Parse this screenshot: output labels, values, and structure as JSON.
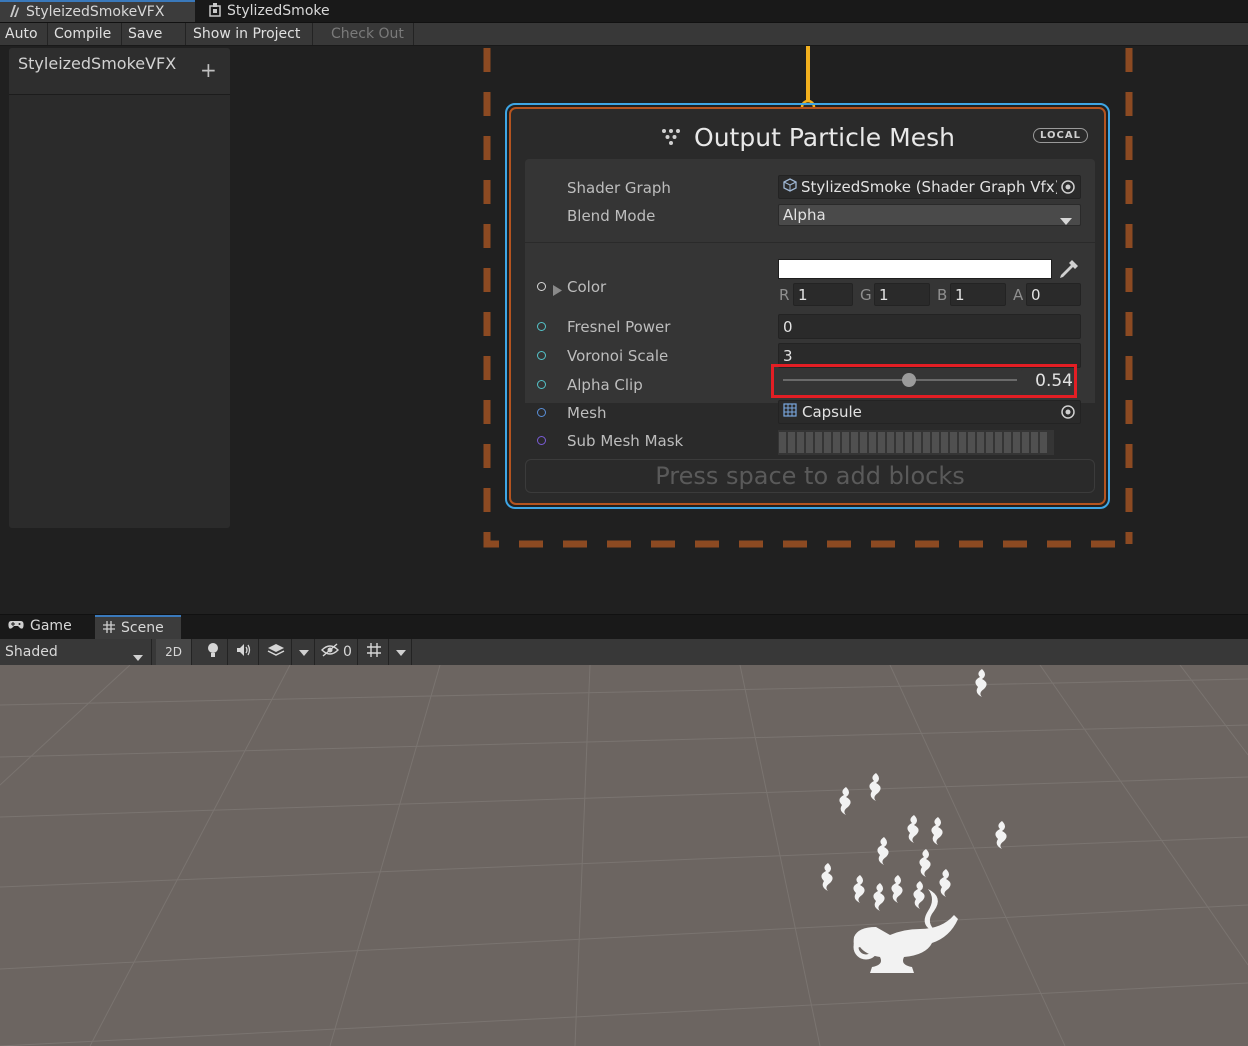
{
  "tabs": [
    {
      "label": "StyleizedSmokeVFX",
      "icon": "vfx-graph-icon"
    },
    {
      "label": "StylizedSmoke",
      "icon": "shader-graph-icon"
    }
  ],
  "toolbar": {
    "auto": "Auto",
    "compile": "Compile",
    "save": "Save",
    "show_in_project": "Show in Project",
    "check_out": "Check Out"
  },
  "blackboard": {
    "title": "StyleizedSmokeVFX",
    "add": "+"
  },
  "node": {
    "title": "Output Particle Mesh",
    "badge": "LOCAL",
    "title_icon": "output-particle-icon",
    "accent_color": "#3ea6e6",
    "context_color": "#b5541f",
    "settings": {
      "shader_graph_label": "Shader Graph",
      "shader_graph_value": "StylizedSmoke (Shader Graph Vfx)",
      "blend_mode_label": "Blend Mode",
      "blend_mode_value": "Alpha"
    },
    "properties": {
      "color": {
        "label": "Color",
        "r_label": "R",
        "r": "1",
        "g_label": "G",
        "g": "1",
        "b_label": "B",
        "b": "1",
        "a_label": "A",
        "a": "0"
      },
      "fresnel_power": {
        "label": "Fresnel Power",
        "value": "0"
      },
      "voronoi_scale": {
        "label": "Voronoi Scale",
        "value": "3"
      },
      "alpha_clip": {
        "label": "Alpha Clip",
        "value": "0.54",
        "slider_fraction": 0.54
      },
      "mesh": {
        "label": "Mesh",
        "value": "Capsule"
      },
      "sub_mesh_mask": {
        "label": "Sub Mesh Mask"
      }
    },
    "add_blocks_hint": "Press space to add blocks"
  },
  "scene_tabs": [
    {
      "label": "Game",
      "icon": "gamepad-icon"
    },
    {
      "label": "Scene",
      "icon": "grid-hash-icon"
    }
  ],
  "scene_toolbar": {
    "draw_mode": "Shaded",
    "mode_2d": "2D",
    "hidden_count": "0"
  },
  "colors": {
    "highlight": "#e31e24",
    "flow_connection": "#f2b01e",
    "scene_ground": "#6c6561"
  }
}
